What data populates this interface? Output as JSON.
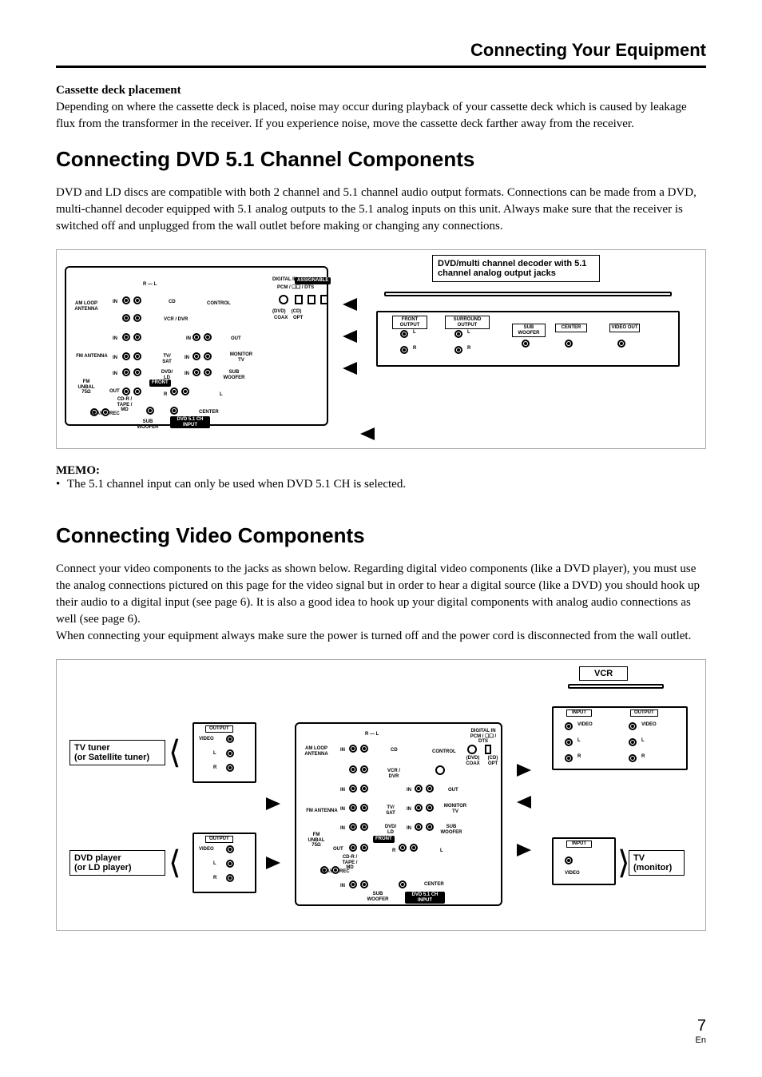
{
  "header": {
    "chapter_title": "Connecting Your Equipment"
  },
  "cassette": {
    "heading": "Cassette deck placement",
    "body": "Depending on where the cassette deck is placed, noise may occur during playback of your cassette deck which is caused by leakage flux from the transformer in the receiver. If you experience noise, move the cassette deck farther away from the receiver."
  },
  "dvd51": {
    "heading": "Connecting DVD 5.1 Channel Components",
    "body": "DVD and LD discs are compatible with both 2 channel and 5.1 channel audio output formats. Connections can be made from a DVD, multi-channel decoder equipped with 5.1 analog outputs to the 5.1 analog inputs on this unit. Always make sure that the receiver is switched off and unplugged from the wall outlet before making or changing any connections.",
    "diagram": {
      "device_title": "DVD/multi channel decoder with 5.1 channel analog output jacks",
      "outputs": {
        "front": "FRONT OUTPUT",
        "surround": "SURROUND OUTPUT",
        "sub": "SUB WOOFER",
        "center": "CENTER",
        "video": "VIDEO OUT",
        "l": "L",
        "r": "R"
      },
      "receiver": {
        "am_loop": "AM LOOP ANTENNA",
        "fm_antenna": "FM ANTENNA",
        "fm_unbal": "FM UNBAL 75Ω",
        "rl": "R — L",
        "cd": "CD",
        "in": "IN",
        "out": "OUT",
        "vcr_dvr": "VCR / DVR",
        "tv_sat": "TV/ SAT",
        "dvd_ld": "DVD/ LD",
        "front": "FRONT",
        "sub_woofer": "SUB WOOFER",
        "center": "CENTER",
        "dvd51_input": "DVD 5.1 CH INPUT",
        "digital_in": "DIGITAL IN",
        "assignable": "ASSIGNABLE",
        "pcm": "PCM / ❏❏ / DTS",
        "dvd_opt": "(DVD)",
        "cd_opt": "(CD)",
        "coax": "COAX",
        "opt": "OPT",
        "control": "CONTROL",
        "monitor_tv": "MONITOR TV",
        "play": "PLAY",
        "rec": "REC",
        "cd_r_tape_md": "CD-R / TAPE / MD"
      },
      "memo_label": "MEMO:",
      "memo_item": "The 5.1 channel input can only be used when DVD 5.1 CH  is selected."
    }
  },
  "video": {
    "heading": "Connecting Video Components",
    "body": "Connect your video components to the jacks as shown below. Regarding digital video components (like a DVD player), you must use the analog connections pictured on this page for the video signal but in order to hear a digital source (like a DVD) you should hook up their audio to a digital input (see page 6). It is also a good idea to hook up your digital components with analog audio connections as well (see page 6).\nWhen connecting your equipment always make sure the power is turned off and the power cord is disconnected from the wall outlet.",
    "diagram": {
      "vcr": "VCR",
      "input": "INPUT",
      "output": "OUTPUT",
      "video_lbl": "VIDEO",
      "l": "L",
      "r": "R",
      "tv_tuner": "TV tuner\n(or Satellite tuner)",
      "dvd_player": "DVD player\n(or LD player)",
      "tv_monitor": "TV\n(monitor)",
      "receiver": {
        "am_loop": "AM LOOP ANTENNA",
        "fm_antenna": "FM ANTENNA",
        "fm_unbal": "FM UNBAL 75Ω",
        "rl": "R — L",
        "cd": "CD",
        "in": "IN",
        "out": "OUT",
        "vcr_dvr": "VCR / DVR",
        "tv_sat": "TV/ SAT",
        "dvd_ld": "DVD/ LD",
        "front": "FRONT",
        "sub_woofer": "SUB WOOFER",
        "center": "CENTER",
        "dvd51_input": "DVD 5.1 CH INPUT",
        "digital_in_line": "DIGITAL IN\nPCM / ❏❏ / DTS",
        "dvd_coax": "(DVD) COAX",
        "cd_opt_col": "(CD) OPT",
        "control": "CONTROL",
        "monitor_tv": "MONITOR TV",
        "play": "PLAY",
        "rec": "REC",
        "cd_r_tape_md": "CD-R / TAPE / MD"
      }
    }
  },
  "footer": {
    "page": "7",
    "lang": "En"
  }
}
